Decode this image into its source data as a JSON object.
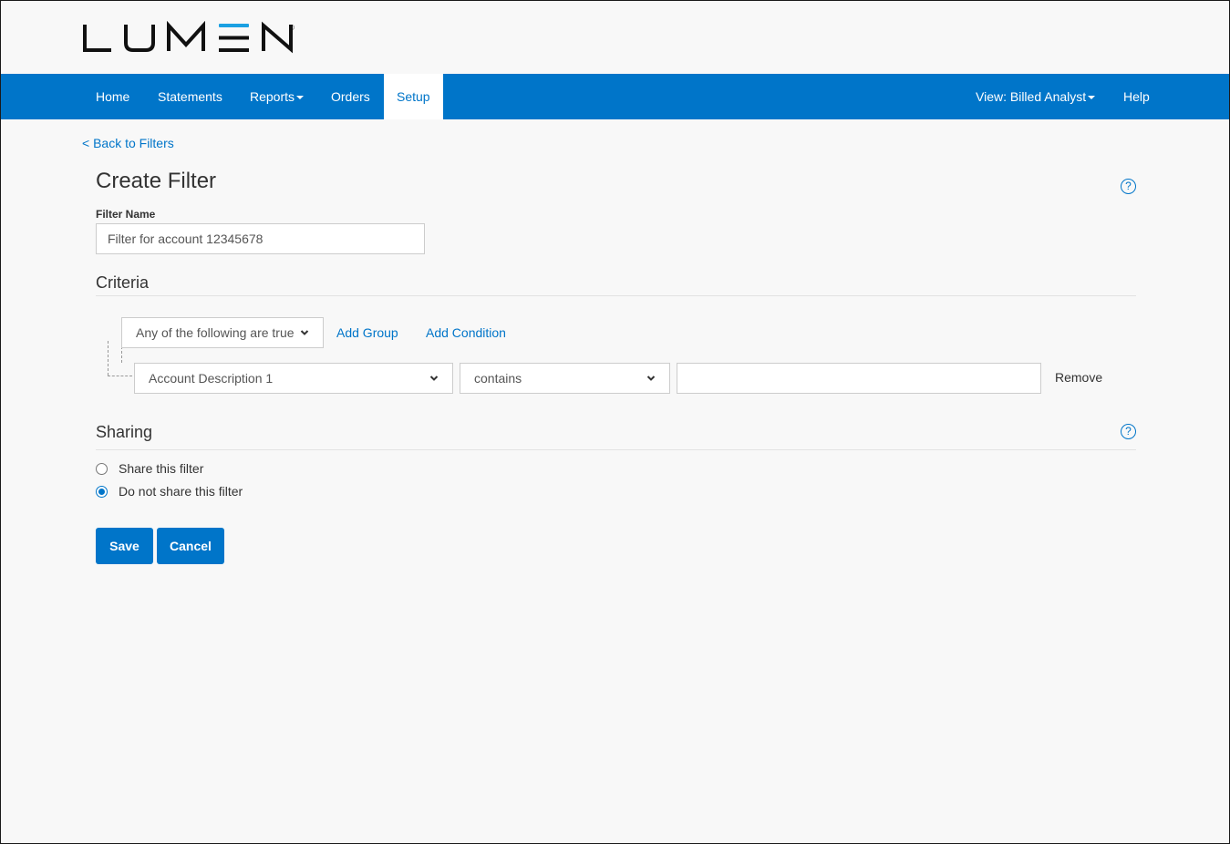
{
  "brand": {
    "name": "LUMEN",
    "accent": "#0075c9",
    "logo_accent": "#1ba0e2"
  },
  "nav": {
    "items": [
      {
        "label": "Home"
      },
      {
        "label": "Statements"
      },
      {
        "label": "Reports",
        "dropdown": true
      },
      {
        "label": "Orders"
      },
      {
        "label": "Setup",
        "active": true
      }
    ],
    "view_label": "View: Billed Analyst",
    "help_label": "Help"
  },
  "page": {
    "back_link": "< Back to Filters",
    "title": "Create Filter",
    "help_icon": "question-circle-icon"
  },
  "filter_name": {
    "label": "Filter Name",
    "value": "Filter for account 12345678"
  },
  "criteria": {
    "title": "Criteria",
    "group_match": "Any of the following are true",
    "add_group": "Add Group",
    "add_condition": "Add Condition",
    "condition": {
      "field": "Account Description 1",
      "operator": "contains",
      "value": "",
      "remove_label": "Remove"
    }
  },
  "sharing": {
    "title": "Sharing",
    "options": [
      {
        "label": "Share this filter",
        "checked": false
      },
      {
        "label": "Do not share this filter",
        "checked": true
      }
    ]
  },
  "actions": {
    "save": "Save",
    "cancel": "Cancel"
  }
}
